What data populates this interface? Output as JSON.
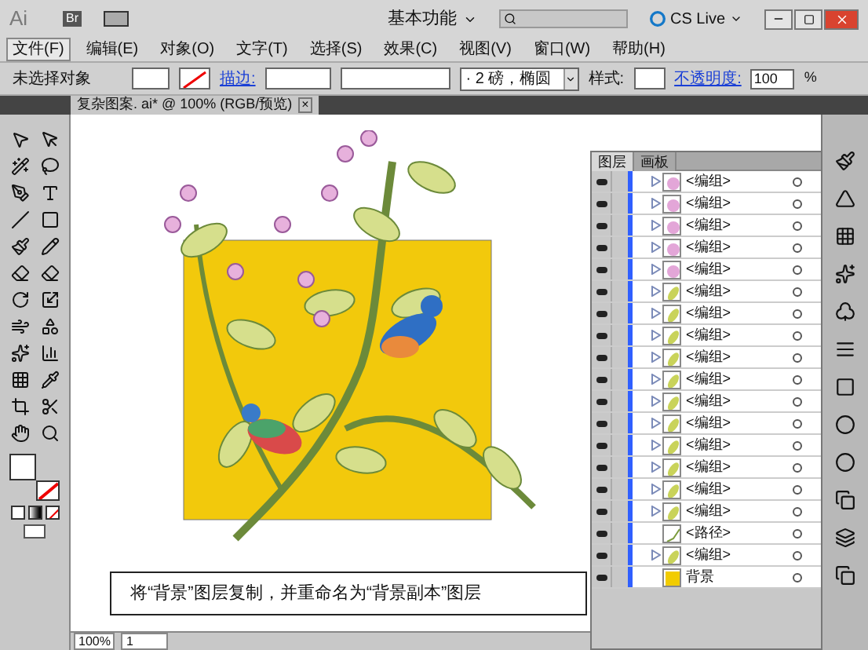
{
  "app_bar": {
    "logo": "Ai",
    "bridge": "Br",
    "workspace": "基本功能",
    "cs_live": "CS Live"
  },
  "menu": [
    {
      "label": "文件(F)",
      "selected": true
    },
    {
      "label": "编辑(E)",
      "selected": false
    },
    {
      "label": "对象(O)",
      "selected": false
    },
    {
      "label": "文字(T)",
      "selected": false
    },
    {
      "label": "选择(S)",
      "selected": false
    },
    {
      "label": "效果(C)",
      "selected": false
    },
    {
      "label": "视图(V)",
      "selected": false
    },
    {
      "label": "窗口(W)",
      "selected": false
    },
    {
      "label": "帮助(H)",
      "selected": false
    }
  ],
  "control_bar": {
    "selection": "未选择对象",
    "stroke_label": "描边:",
    "brush": "· 2 磅，椭圆",
    "style_label": "样式:",
    "opacity_label": "不透明度:",
    "opacity": "100",
    "percent": "%"
  },
  "document_tab": {
    "title": "复杂图案. ai* @ 100% (RGB/预览)",
    "close": "×"
  },
  "layers_panel": {
    "tabs": [
      {
        "label": "图层",
        "selected": true
      },
      {
        "label": "画板",
        "selected": false
      }
    ],
    "rows": [
      {
        "name": "<编组>",
        "kind": "flower"
      },
      {
        "name": "<编组>",
        "kind": "flower"
      },
      {
        "name": "<编组>",
        "kind": "flower"
      },
      {
        "name": "<编组>",
        "kind": "flower"
      },
      {
        "name": "<编组>",
        "kind": "flower"
      },
      {
        "name": "<编组>",
        "kind": "leaf"
      },
      {
        "name": "<编组>",
        "kind": "leaf"
      },
      {
        "name": "<编组>",
        "kind": "leaf"
      },
      {
        "name": "<编组>",
        "kind": "leaf"
      },
      {
        "name": "<编组>",
        "kind": "leaf"
      },
      {
        "name": "<编组>",
        "kind": "leaf"
      },
      {
        "name": "<编组>",
        "kind": "leaf"
      },
      {
        "name": "<编组>",
        "kind": "leaf"
      },
      {
        "name": "<编组>",
        "kind": "leaf"
      },
      {
        "name": "<编组>",
        "kind": "leaf"
      },
      {
        "name": "<编组>",
        "kind": "leaf"
      },
      {
        "name": "<路径>",
        "kind": "path"
      },
      {
        "name": "<编组>",
        "kind": "leaf"
      },
      {
        "name": "背景",
        "kind": "background"
      }
    ]
  },
  "caption": "将“背景”图层复制，并重命名为“背景副本”图层",
  "status_bar": {
    "zoom": "100%",
    "artboard": "1"
  }
}
